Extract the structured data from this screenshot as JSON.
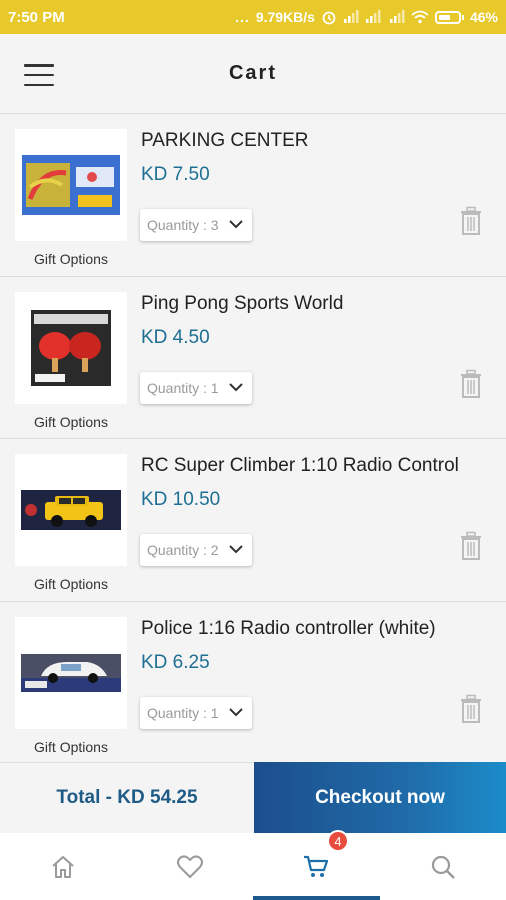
{
  "status_bar": {
    "time": "7:50 PM",
    "dots": "...",
    "network_speed": "9.79KB/s",
    "battery": "46%"
  },
  "header": {
    "title": "Cart",
    "menu_icon": "hamburger-menu-icon"
  },
  "cart": {
    "items": [
      {
        "name": "PARKING CENTER",
        "price": "KD 7.50",
        "quantity_label": "Quantity : 3",
        "gift_label": "Gift Options"
      },
      {
        "name": "Ping Pong Sports World",
        "price": "KD 4.50",
        "quantity_label": "Quantity : 1",
        "gift_label": "Gift Options"
      },
      {
        "name": "RC Super Climber 1:10 Radio Control",
        "price": "KD 10.50",
        "quantity_label": "Quantity : 2",
        "gift_label": "Gift Options"
      },
      {
        "name": "Police 1:16 Radio controller (white)",
        "price": "KD 6.25",
        "quantity_label": "Quantity : 1",
        "gift_label": "Gift Options"
      }
    ]
  },
  "checkout": {
    "total_label": "Total - KD 54.25",
    "button_label": "Checkout now"
  },
  "nav": {
    "items": [
      "home-icon",
      "heart-icon",
      "cart-icon",
      "search-icon"
    ],
    "active": "cart-icon",
    "cart_badge": "4"
  },
  "colors": {
    "status_bar": "#e8c92b",
    "price": "#1e6f94",
    "total_text": "#1e5c86",
    "checkout_button": "#1f6ba8",
    "badge": "#e74c3c",
    "active_nav": "#1c5a8e"
  }
}
